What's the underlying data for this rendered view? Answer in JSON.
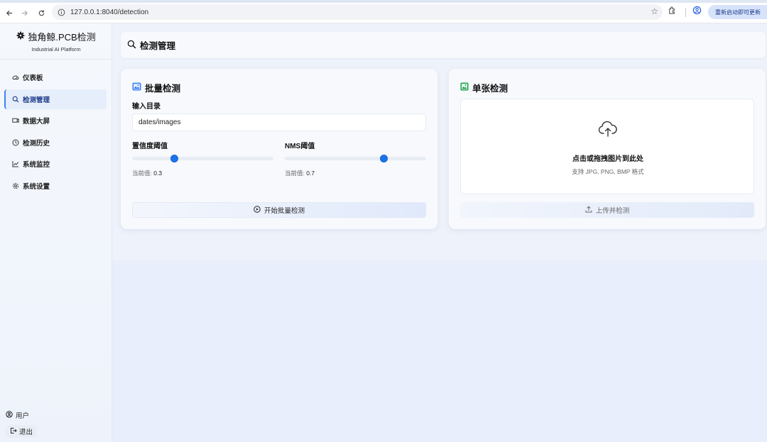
{
  "browser": {
    "url": "127.0.0.1:8040/detection",
    "update_label": "重新启动即可更新"
  },
  "sidebar": {
    "brand_title": "独角鲸.PCB检测",
    "brand_sub": "Industrial AI Platform",
    "items": [
      {
        "label": "仪表板",
        "icon": "dashboard-icon"
      },
      {
        "label": "检测管理",
        "icon": "search-icon",
        "active": true
      },
      {
        "label": "数据大屏",
        "icon": "screen-icon"
      },
      {
        "label": "检测历史",
        "icon": "history-icon"
      },
      {
        "label": "系统监控",
        "icon": "chart-icon"
      },
      {
        "label": "系统设置",
        "icon": "gear-icon"
      }
    ],
    "user_label": "用户",
    "logout_label": "退出"
  },
  "header": {
    "title": "检测管理"
  },
  "batch": {
    "title": "批量检测",
    "dir_label": "输入目录",
    "dir_value": "dates/images",
    "conf_label": "置信度阈值",
    "conf_prefix": "当前值:",
    "conf_value": "0.3",
    "conf_fraction": 0.3,
    "nms_label": "NMS阈值",
    "nms_prefix": "当前值:",
    "nms_value": "0.7",
    "nms_fraction": 0.7,
    "start_label": "开始批量检测"
  },
  "single": {
    "title": "单张检测",
    "drop_main": "点击或拖拽图片到此处",
    "drop_sub": "支持 JPG, PNG, BMP 格式",
    "upload_label": "上传并检测"
  },
  "colors": {
    "accent": "#1a73e8",
    "active_bg": "#e6eefb"
  }
}
